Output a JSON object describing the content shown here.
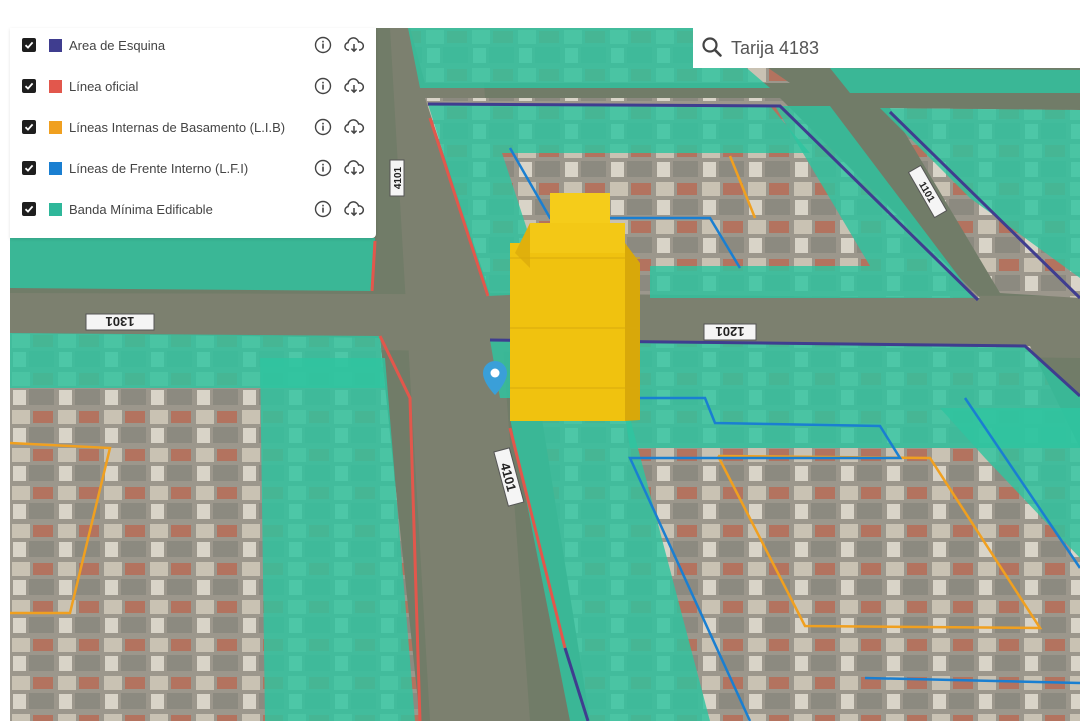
{
  "search": {
    "value": "Tarija 4183"
  },
  "layers": [
    {
      "label": "Area de Esquina",
      "color": "#3f3d8f",
      "checked": true
    },
    {
      "label": "Línea oficial",
      "color": "#e2574c",
      "checked": true
    },
    {
      "label": "Líneas Internas de Basamento (L.I.B)",
      "color": "#f0a020",
      "checked": true
    },
    {
      "label": "Líneas de Frente Interno (L.F.I)",
      "color": "#1a7fd1",
      "checked": true
    },
    {
      "label": "Banda Mínima Edificable",
      "color": "#2fb79a",
      "checked": true
    }
  ],
  "map": {
    "street_numbers": [
      "1301",
      "1201",
      "4101",
      "4101",
      "1101"
    ],
    "building_color": "#f0c20f",
    "band_color": "#2ec4a0",
    "marker_color": "#3a9fd8"
  }
}
